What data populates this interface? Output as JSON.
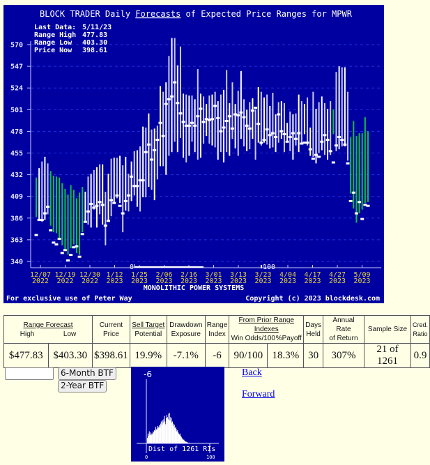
{
  "chart_data": {
    "type": "range-bar",
    "title_prefix": "BLOCK TRADER Daily ",
    "title_link": "Forecasts",
    "title_suffix": " of Expected Price Ranges for  MPWR",
    "info": {
      "last_data_label": "Last Data:",
      "last_data": "5/11/23",
      "range_high_label": "Range High",
      "range_high": "477.83",
      "range_low_label": "Range Low",
      "range_low": "403.30",
      "price_now_label": "Price Now",
      "price_now": "398.61"
    },
    "ylim": [
      340,
      570
    ],
    "yticks": [
      570,
      547,
      524,
      501,
      478,
      455,
      432,
      409,
      386,
      363,
      340
    ],
    "xtick_labels": [
      [
        "12/07",
        "2022"
      ],
      [
        "12/19",
        "2022"
      ],
      [
        "12/30",
        "2022"
      ],
      [
        "1/12",
        "2023"
      ],
      [
        "1/25",
        "2023"
      ],
      [
        "2/06",
        "2023"
      ],
      [
        "2/16",
        "2023"
      ],
      [
        "3/01",
        "2023"
      ],
      [
        "3/13",
        "2023"
      ],
      [
        "3/23",
        "2023"
      ],
      [
        "4/04",
        "2023"
      ],
      [
        "4/17",
        "2023"
      ],
      [
        "4/27",
        "2023"
      ],
      [
        "5/09",
        "2023"
      ]
    ],
    "xlabel": "MONOLITHIC POWER SYSTEMS",
    "ri_scale": {
      "low_label": "0",
      "high_label": "100",
      "current_value": -6
    },
    "footer_left": "For exclusive use of Peter Way",
    "footer_right": "Copyright (c) 2023 blockdesk.com",
    "series_note": "each bar: [high, low, price, color] color g=green (price below range), w=white",
    "bars": [
      [
        429,
        387,
        368,
        "g"
      ],
      [
        439,
        384,
        384,
        "w"
      ],
      [
        446,
        382,
        384,
        "w"
      ],
      [
        451,
        384,
        391,
        "w"
      ],
      [
        444,
        390,
        398,
        "w"
      ],
      [
        436,
        378,
        373,
        "g"
      ],
      [
        431,
        371,
        360,
        "g"
      ],
      [
        430,
        370,
        358,
        "g"
      ],
      [
        429,
        364,
        364,
        "g"
      ],
      [
        423,
        357,
        349,
        "g"
      ],
      [
        417,
        352,
        352,
        "g"
      ],
      [
        411,
        347,
        341,
        "g"
      ],
      [
        421,
        354,
        347,
        "g"
      ],
      [
        416,
        358,
        355,
        "g"
      ],
      [
        407,
        349,
        356,
        "g"
      ],
      [
        413,
        347,
        345,
        "g"
      ],
      [
        419,
        371,
        369,
        "g"
      ],
      [
        414,
        383,
        382,
        "w"
      ],
      [
        430,
        379,
        393,
        "w"
      ],
      [
        433,
        376,
        401,
        "w"
      ],
      [
        437,
        395,
        397,
        "w"
      ],
      [
        440,
        376,
        399,
        "w"
      ],
      [
        443,
        390,
        403,
        "w"
      ],
      [
        443,
        379,
        400,
        "w"
      ],
      [
        414,
        357,
        378,
        "w"
      ],
      [
        433,
        384,
        383,
        "w"
      ],
      [
        449,
        388,
        405,
        "w"
      ],
      [
        450,
        403,
        402,
        "w"
      ],
      [
        450,
        407,
        410,
        "w"
      ],
      [
        452,
        402,
        399,
        "w"
      ],
      [
        442,
        371,
        391,
        "w"
      ],
      [
        451,
        394,
        404,
        "w"
      ],
      [
        433,
        393,
        410,
        "w"
      ],
      [
        446,
        404,
        430,
        "w"
      ],
      [
        457,
        410,
        420,
        "w"
      ],
      [
        458,
        398,
        420,
        "w"
      ],
      [
        462,
        393,
        426,
        "w"
      ],
      [
        483,
        408,
        426,
        "w"
      ],
      [
        482,
        408,
        456,
        "w"
      ],
      [
        497,
        419,
        464,
        "w"
      ],
      [
        480,
        416,
        448,
        "w"
      ],
      [
        481,
        405,
        458,
        "w"
      ],
      [
        484,
        427,
        469,
        "w"
      ],
      [
        526,
        441,
        487,
        "w"
      ],
      [
        520,
        441,
        473,
        "w"
      ],
      [
        530,
        432,
        507,
        "w"
      ],
      [
        558,
        452,
        512,
        "w"
      ],
      [
        577,
        456,
        515,
        "w"
      ],
      [
        577,
        467,
        530,
        "w"
      ],
      [
        548,
        456,
        508,
        "w"
      ],
      [
        568,
        471,
        497,
        "w"
      ],
      [
        518,
        450,
        488,
        "w"
      ],
      [
        517,
        445,
        484,
        "w"
      ],
      [
        516,
        452,
        484,
        "w"
      ],
      [
        516,
        467,
        487,
        "w"
      ],
      [
        512,
        456,
        484,
        "w"
      ],
      [
        544,
        448,
        494,
        "w"
      ],
      [
        518,
        450,
        502,
        "w"
      ],
      [
        515,
        465,
        488,
        "w"
      ],
      [
        507,
        473,
        491,
        "w"
      ],
      [
        516,
        465,
        490,
        "w"
      ],
      [
        517,
        463,
        491,
        "w"
      ],
      [
        520,
        461,
        505,
        "w"
      ],
      [
        510,
        448,
        492,
        "w"
      ],
      [
        517,
        456,
        478,
        "w"
      ],
      [
        522,
        445,
        482,
        "w"
      ],
      [
        543,
        456,
        489,
        "w"
      ],
      [
        508,
        452,
        494,
        "w"
      ],
      [
        530,
        470,
        481,
        "w"
      ],
      [
        507,
        460,
        496,
        "w"
      ],
      [
        521,
        452,
        495,
        "w"
      ],
      [
        542,
        470,
        498,
        "w"
      ],
      [
        512,
        462,
        493,
        "w"
      ],
      [
        501,
        457,
        484,
        "w"
      ],
      [
        509,
        459,
        481,
        "w"
      ],
      [
        513,
        470,
        500,
        "w"
      ],
      [
        501,
        448,
        503,
        "w"
      ],
      [
        525,
        466,
        486,
        "w"
      ],
      [
        520,
        463,
        466,
        "w"
      ],
      [
        514,
        466,
        469,
        "w"
      ],
      [
        517,
        464,
        480,
        "w"
      ],
      [
        505,
        460,
        474,
        "w"
      ],
      [
        519,
        461,
        476,
        "w"
      ],
      [
        496,
        456,
        472,
        "w"
      ],
      [
        509,
        466,
        496,
        "w"
      ],
      [
        510,
        470,
        478,
        "w"
      ],
      [
        508,
        456,
        475,
        "w"
      ],
      [
        487,
        466,
        467,
        "w"
      ],
      [
        499,
        457,
        472,
        "w"
      ],
      [
        496,
        448,
        476,
        "w"
      ],
      [
        497,
        463,
        470,
        "w"
      ],
      [
        517,
        456,
        476,
        "w"
      ],
      [
        510,
        466,
        465,
        "w"
      ],
      [
        507,
        475,
        466,
        "w"
      ],
      [
        514,
        463,
        466,
        "w"
      ],
      [
        482,
        452,
        459,
        "w"
      ],
      [
        520,
        451,
        449,
        "w"
      ],
      [
        502,
        444,
        453,
        "w"
      ],
      [
        509,
        455,
        451,
        "w"
      ],
      [
        515,
        458,
        467,
        "w"
      ],
      [
        508,
        453,
        474,
        "w"
      ],
      [
        502,
        448,
        469,
        "w"
      ],
      [
        510,
        453,
        457,
        "w"
      ],
      [
        501,
        475,
        445,
        "g"
      ],
      [
        541,
        457,
        463,
        "w"
      ],
      [
        547,
        459,
        472,
        "w"
      ],
      [
        546,
        462,
        469,
        "w"
      ],
      [
        546,
        462,
        464,
        "w"
      ],
      [
        520,
        447,
        444,
        "w"
      ],
      [
        472,
        412,
        404,
        "g"
      ],
      [
        489,
        396,
        413,
        "g"
      ],
      [
        473,
        381,
        391,
        "g"
      ],
      [
        476,
        391,
        403,
        "g"
      ],
      [
        476,
        395,
        385,
        "g"
      ],
      [
        493,
        402,
        400,
        "g"
      ],
      [
        478,
        403,
        399,
        "g"
      ]
    ]
  },
  "table": {
    "headers": {
      "range_forecast": "Range Forecast",
      "high": "High",
      "low": "Low",
      "current_price_1": "Current",
      "current_price_2": "Price",
      "sell_target_1": "Sell Target",
      "sell_target_2": "Potential",
      "drawdown_1": "Drawdown",
      "drawdown_2": "Exposure",
      "range_index_1": "Range",
      "range_index_2": "Index",
      "prior_ri": "From Prior Range Indexes",
      "win_odds": "Win Odds/100",
      "payoff": "%Payoff",
      "days_held_1": "Days",
      "days_held_2": "Held",
      "annual_rate_1": "Annual Rate",
      "annual_rate_2": "of Return",
      "sample_size": "Sample Size",
      "cred_ratio_1": "Cred.",
      "cred_ratio_2": "Ratio"
    },
    "values": {
      "high": "$477.83",
      "low": "$403.30",
      "current_price": "$398.61",
      "sell_target": "19.9%",
      "drawdown": "-7.1%",
      "range_index": "-6",
      "win_odds": "90/100",
      "payoff": "18.3%",
      "days_held": "30",
      "annual_rate": "307%",
      "sample_size": "21 of 1261",
      "cred_ratio": "0.9"
    }
  },
  "controls": {
    "symbol_input_value": "",
    "btn_6month": "6-Month BTF",
    "btn_2year": "2-Year BTF",
    "link_back": "Back",
    "link_forward": "Forward"
  },
  "distribution": {
    "marker_label": "-6",
    "caption": "Dist of 1261 RIs",
    "axis_low": "0",
    "axis_high": "100",
    "histogram": [
      10,
      18,
      14,
      22,
      16,
      20,
      15,
      18,
      17,
      22,
      20,
      24,
      23,
      30,
      26,
      25,
      32,
      28,
      30,
      33,
      29,
      36,
      40,
      34,
      42,
      38,
      44,
      50,
      40,
      35,
      46,
      52,
      48,
      44,
      54,
      56,
      42,
      48,
      46,
      38,
      40,
      36,
      32,
      34,
      28,
      30,
      26,
      22,
      24,
      20,
      18,
      16,
      18,
      14,
      12,
      10,
      8,
      6,
      7,
      5,
      4,
      3,
      3,
      2,
      2,
      1,
      1,
      1,
      0,
      0,
      0,
      0,
      0,
      0,
      0,
      0,
      0,
      0,
      0,
      0,
      0,
      0,
      0,
      0,
      0,
      0,
      0,
      0,
      0,
      0,
      0,
      0,
      0,
      0,
      0,
      0,
      0,
      0,
      0,
      0
    ]
  }
}
